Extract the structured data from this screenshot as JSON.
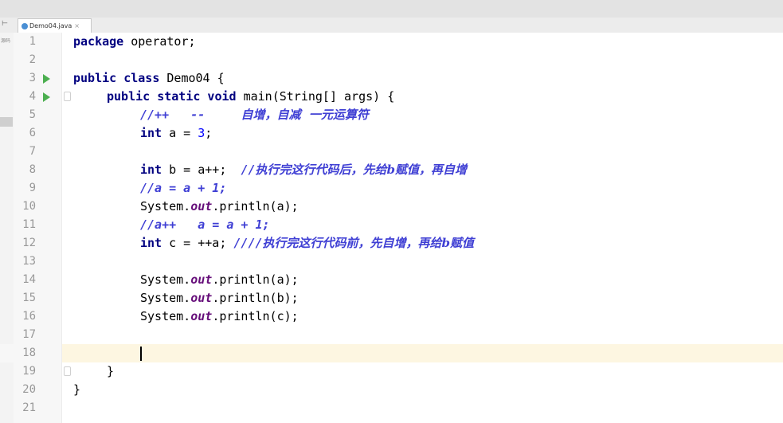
{
  "tab": {
    "label": "Demo04.java",
    "close": "×"
  },
  "left_tool": {
    "top": "⊢",
    "label": "源码"
  },
  "colors": {
    "keyword": "#000080",
    "number": "#0000ff",
    "comment": "#3f3fd4",
    "static_field": "#660e7a",
    "current_line": "#fdf6e1",
    "run_icon": "#4caf50"
  },
  "icons": {
    "run_line_3": "run-icon",
    "run_line_4": "run-icon",
    "file_tab": "java-class-icon"
  },
  "editor": {
    "current_line": 18,
    "line_numbers": [
      "1",
      "2",
      "3",
      "4",
      "5",
      "6",
      "7",
      "8",
      "9",
      "10",
      "11",
      "12",
      "13",
      "14",
      "15",
      "16",
      "17",
      "18",
      "19",
      "20",
      "21"
    ],
    "lines": {
      "l1": {
        "kw": "package",
        "rest": " operator;"
      },
      "l3": {
        "kw": "public class",
        "rest": " Demo04 {"
      },
      "l4": {
        "kw": "public static void",
        "rest": " main(String[] args) {"
      },
      "l5": {
        "comment_a": "//++   --     ",
        "comment_b": "自增，自减  一元运算符"
      },
      "l6": {
        "kw": "int",
        "rest_a": " a = ",
        "num": "3",
        "rest_b": ";"
      },
      "l8": {
        "kw": "int",
        "rest": " b = a++;  ",
        "comment_a": "//",
        "comment_b": "执行完这行代码后，先给b赋值，再自增"
      },
      "l9": {
        "comment": "//a = a + 1;"
      },
      "l10": {
        "a": "System.",
        "field": "out",
        "b": ".println(a);"
      },
      "l11": {
        "comment": "//a++   a = a + 1;"
      },
      "l12": {
        "kw": "int",
        "rest": " c = ++a; ",
        "comment_a": "////",
        "comment_b": "执行完这行代码前，先自增，再给b赋值"
      },
      "l14": {
        "a": "System.",
        "field": "out",
        "b": ".println(a);"
      },
      "l15": {
        "a": "System.",
        "field": "out",
        "b": ".println(b);"
      },
      "l16": {
        "a": "System.",
        "field": "out",
        "b": ".println(c);"
      },
      "l19": {
        "text": "}"
      },
      "l20": {
        "text": "}"
      }
    }
  }
}
